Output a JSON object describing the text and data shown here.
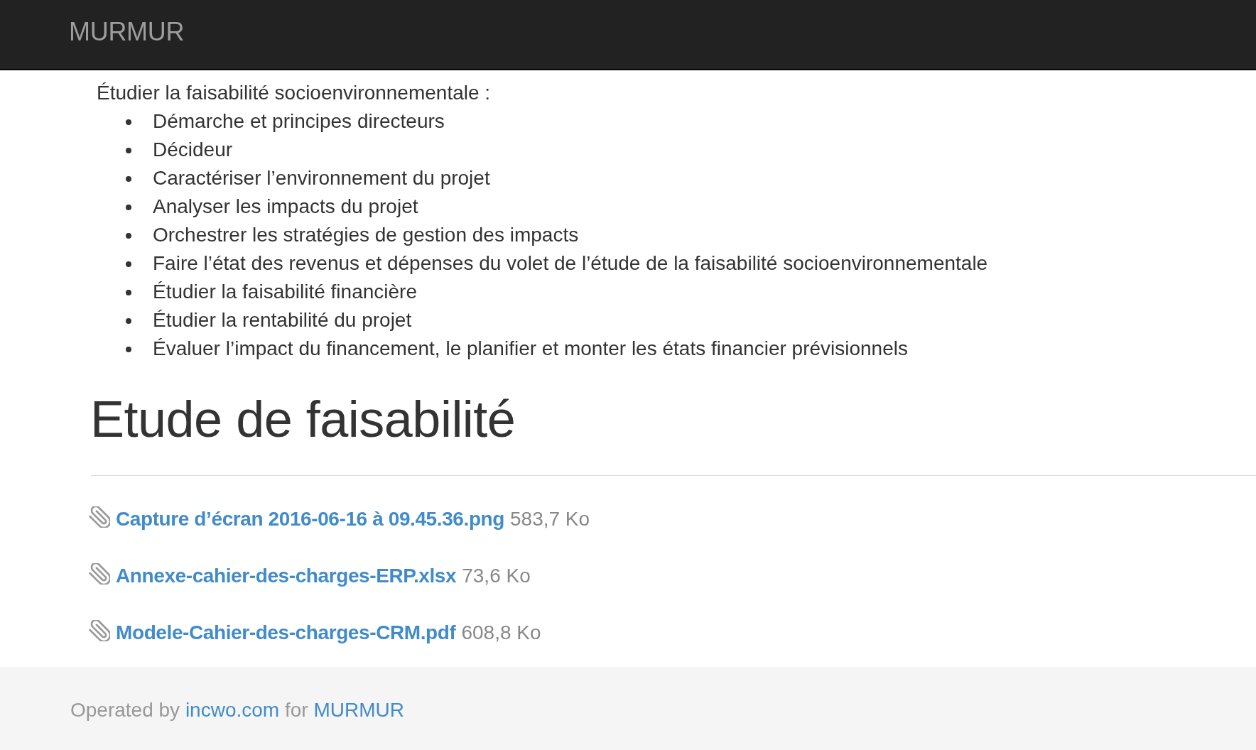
{
  "navbar": {
    "brand": "MURMUR"
  },
  "content": {
    "intro": "Étudier la faisabilité socioenvironnementale :",
    "items": [
      "Démarche et principes directeurs",
      "Décideur",
      "Caractériser l’environnement du projet",
      "Analyser les impacts du projet",
      "Orchestrer les stratégies de gestion des impacts",
      "Faire l’état des revenus et dépenses du volet de l’étude de la faisabilité socioenvironnementale",
      "Étudier la faisabilité financière",
      "Étudier la rentabilité du projet",
      "Évaluer l’impact du financement, le planifier et monter les états financier prévisionnels"
    ]
  },
  "section": {
    "title": "Etude de faisabilité",
    "attachments": [
      {
        "name": "Capture d’écran 2016-06-16 à 09.45.36.png",
        "size": "583,7 Ko"
      },
      {
        "name": "Annexe-cahier-des-charges-ERP.xlsx",
        "size": "73,6 Ko"
      },
      {
        "name": "Modele-Cahier-des-charges-CRM.pdf",
        "size": "608,8 Ko"
      }
    ]
  },
  "footer": {
    "parts": [
      {
        "kind": "text",
        "text": "Operated by"
      },
      {
        "kind": "link",
        "text": "incwo.com"
      },
      {
        "kind": "text",
        "text": "for"
      },
      {
        "kind": "link",
        "text": "MURMUR"
      }
    ]
  }
}
